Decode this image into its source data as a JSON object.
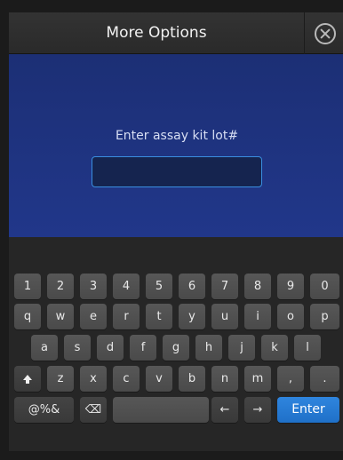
{
  "header": {
    "title": "More Options"
  },
  "form": {
    "prompt": "Enter assay kit lot#",
    "lot_value": ""
  },
  "keyboard": {
    "row1": [
      "1",
      "2",
      "3",
      "4",
      "5",
      "6",
      "7",
      "8",
      "9",
      "0"
    ],
    "row2": [
      "q",
      "w",
      "e",
      "r",
      "t",
      "y",
      "u",
      "i",
      "o",
      "p"
    ],
    "row3": [
      "a",
      "s",
      "d",
      "f",
      "g",
      "h",
      "j",
      "k",
      "l"
    ],
    "row4": [
      "z",
      "x",
      "c",
      "v",
      "b",
      "n",
      "m",
      ",",
      "."
    ],
    "symbols_label": "@%&",
    "backspace_glyph": "⌫",
    "left_arrow": "←",
    "right_arrow": "→",
    "enter_label": "Enter"
  },
  "colors": {
    "accent": "#1f70c8",
    "panel": "#21378a"
  }
}
